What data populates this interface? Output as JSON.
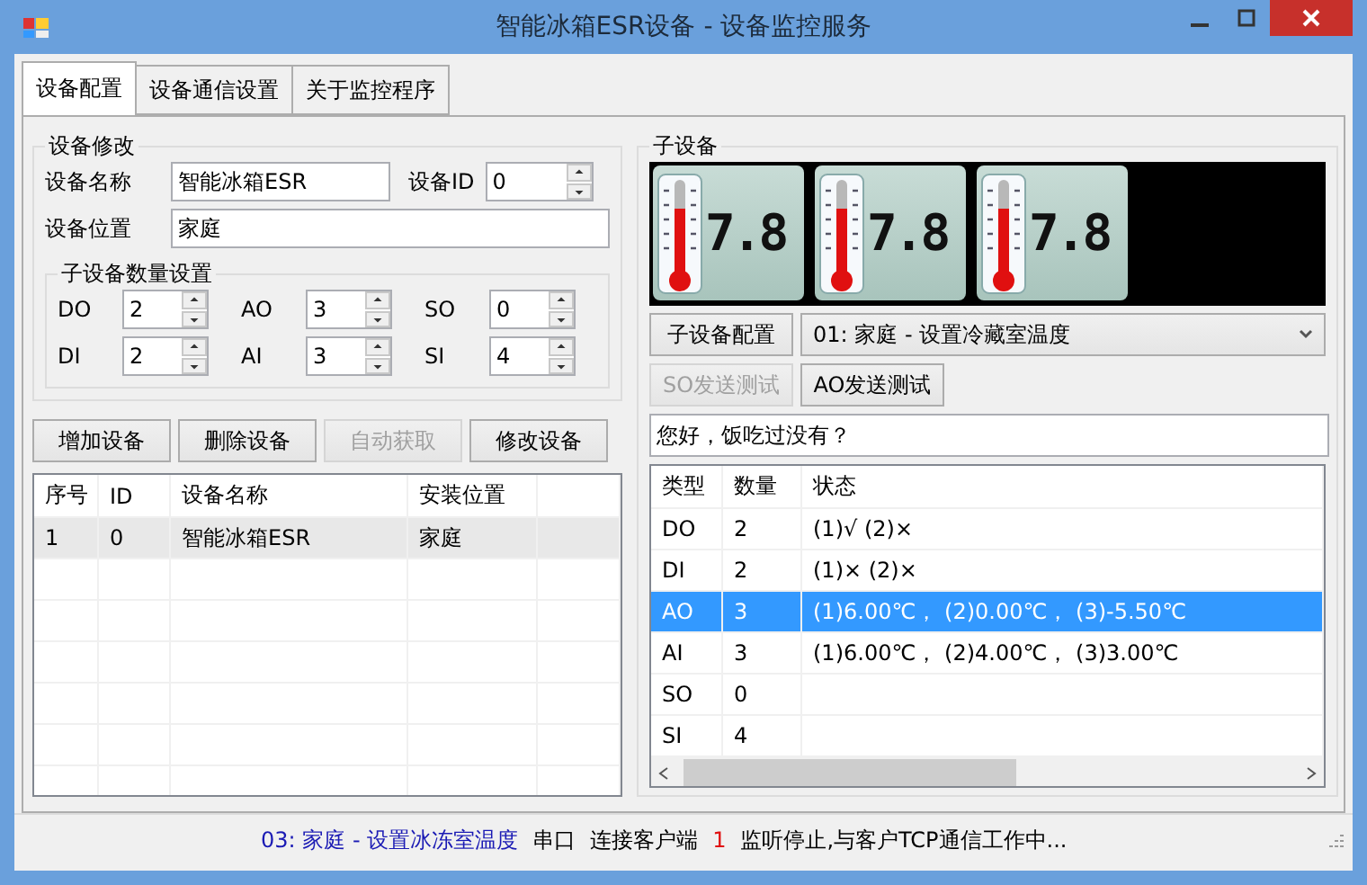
{
  "window": {
    "title": "智能冰箱ESR设备 - 设备监控服务"
  },
  "tabs": [
    {
      "label": "设备配置",
      "selected": true
    },
    {
      "label": "设备通信设置",
      "selected": false
    },
    {
      "label": "关于监控程序",
      "selected": false
    }
  ],
  "device_edit": {
    "title": "设备修改",
    "name_label": "设备名称",
    "name_value": "智能冰箱ESR",
    "id_label": "设备ID",
    "id_value": "0",
    "location_label": "设备位置",
    "location_value": "家庭",
    "counts": {
      "title": "子设备数量设置",
      "fields": [
        {
          "label": "DO",
          "value": "2"
        },
        {
          "label": "AO",
          "value": "3"
        },
        {
          "label": "SO",
          "value": "0"
        },
        {
          "label": "DI",
          "value": "2"
        },
        {
          "label": "AI",
          "value": "3"
        },
        {
          "label": "SI",
          "value": "4"
        }
      ]
    }
  },
  "buttons": [
    {
      "label": "增加设备",
      "disabled": false
    },
    {
      "label": "删除设备",
      "disabled": false
    },
    {
      "label": "自动获取",
      "disabled": true
    },
    {
      "label": "修改设备",
      "disabled": false
    }
  ],
  "device_table": {
    "columns": [
      "序号",
      "ID",
      "设备名称",
      "安装位置"
    ],
    "rows": [
      {
        "cells": [
          "1",
          "0",
          "智能冰箱ESR",
          "家庭"
        ],
        "selected": true
      }
    ]
  },
  "sub_device": {
    "title": "子设备",
    "gauges": [
      {
        "reading": "7.8"
      },
      {
        "reading": "7.8"
      },
      {
        "reading": "7.8"
      }
    ],
    "config_button": "子设备配置",
    "selection": "01: 家庭 - 设置冷藏室温度",
    "test_buttons": [
      {
        "label": "SO发送测试",
        "disabled": true
      },
      {
        "label": "AO发送测试",
        "disabled": false
      }
    ],
    "message": "您好，饭吃过没有？",
    "table": {
      "columns": [
        "类型",
        "数量",
        "状态"
      ],
      "rows": [
        {
          "cells": [
            "DO",
            "2",
            "(1)√ (2)×"
          ],
          "selected": false
        },
        {
          "cells": [
            "DI",
            "2",
            "(1)× (2)×"
          ],
          "selected": false
        },
        {
          "cells": [
            "AO",
            "3",
            "(1)6.00℃， (2)0.00℃， (3)-5.50℃"
          ],
          "selected": true
        },
        {
          "cells": [
            "AI",
            "3",
            "(1)6.00℃， (2)4.00℃， (3)3.00℃"
          ],
          "selected": false
        },
        {
          "cells": [
            "SO",
            "0",
            ""
          ],
          "selected": false
        },
        {
          "cells": [
            "SI",
            "4",
            ""
          ],
          "selected": false
        }
      ]
    }
  },
  "status_bar": [
    {
      "text": "03: 家庭 - 设置冰冻室温度",
      "color": "#1a1ab4"
    },
    {
      "text": "串口",
      "color": "#000000"
    },
    {
      "text": "连接客户端",
      "color": "#000000"
    },
    {
      "text": "1",
      "color": "#e01010"
    },
    {
      "text": "监听停止,与客户TCP通信工作中...",
      "color": "#000000"
    }
  ]
}
